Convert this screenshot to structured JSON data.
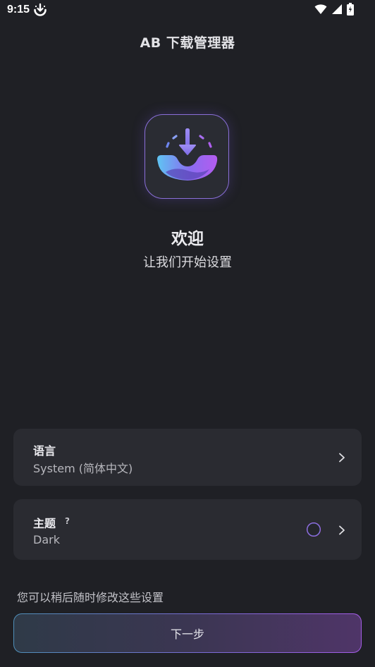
{
  "status_bar": {
    "time": "9:15",
    "app_icon": "download-notification-icon",
    "icons": [
      "wifi-icon",
      "signal-icon",
      "battery-charging-icon"
    ]
  },
  "header": {
    "title": "AB 下载管理器"
  },
  "welcome": {
    "logo_icon": "download-arrow-logo-icon",
    "title": "欢迎",
    "subtitle": "让我们开始设置"
  },
  "settings": {
    "language": {
      "label": "语言",
      "value": "System (简体中文)"
    },
    "theme": {
      "label": "主题",
      "help": "?",
      "value": "Dark"
    }
  },
  "footer": {
    "hint": "您可以稍后随时修改这些设置",
    "next_label": "下一步"
  },
  "colors": {
    "background": "#1f2025",
    "card": "#2a2b31",
    "accent_blue": "#4f8fb8",
    "accent_purple": "#a45ce6"
  }
}
